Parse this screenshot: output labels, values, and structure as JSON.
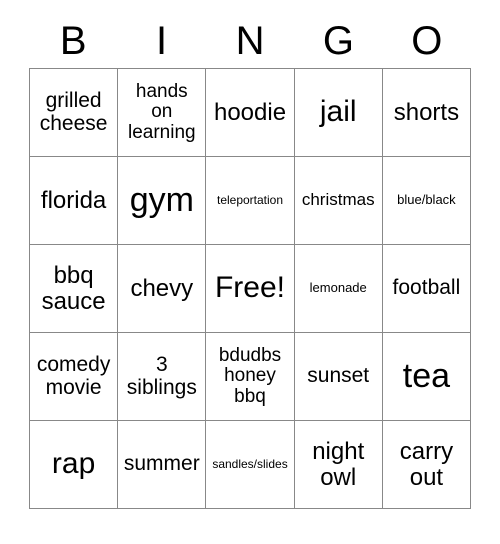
{
  "card": {
    "title_letters": [
      "B",
      "I",
      "N",
      "G",
      "O"
    ],
    "grid": [
      [
        {
          "text": "grilled\ncheese",
          "size": "s-md"
        },
        {
          "text": "hands\non\nlearning",
          "size": "s-sm"
        },
        {
          "text": "hoodie",
          "size": "s-lg"
        },
        {
          "text": "jail",
          "size": "s-xl"
        },
        {
          "text": "shorts",
          "size": "s-lg"
        }
      ],
      [
        {
          "text": "florida",
          "size": "s-lg"
        },
        {
          "text": "gym",
          "size": "s-xxl"
        },
        {
          "text": "teleportation",
          "size": "s-tiny"
        },
        {
          "text": "christmas",
          "size": "s-xs"
        },
        {
          "text": "blue/black",
          "size": "s-xxs"
        }
      ],
      [
        {
          "text": "bbq\nsauce",
          "size": "s-lg"
        },
        {
          "text": "chevy",
          "size": "s-lg"
        },
        {
          "text": "Free!",
          "size": "s-xl"
        },
        {
          "text": "lemonade",
          "size": "s-xxs"
        },
        {
          "text": "football",
          "size": "s-md"
        }
      ],
      [
        {
          "text": "comedy\nmovie",
          "size": "s-md"
        },
        {
          "text": "3\nsiblings",
          "size": "s-md"
        },
        {
          "text": "bdudbs\nhoney\nbbq",
          "size": "s-sm"
        },
        {
          "text": "sunset",
          "size": "s-md"
        },
        {
          "text": "tea",
          "size": "s-xxl"
        }
      ],
      [
        {
          "text": "rap",
          "size": "s-xl"
        },
        {
          "text": "summer",
          "size": "s-md"
        },
        {
          "text": "sandles/slides",
          "size": "s-tiny"
        },
        {
          "text": "night\nowl",
          "size": "s-lg"
        },
        {
          "text": "carry\nout",
          "size": "s-lg"
        }
      ]
    ]
  },
  "colors": {
    "background": "#ffffff",
    "text": "#000000",
    "grid_line": "#888888"
  }
}
